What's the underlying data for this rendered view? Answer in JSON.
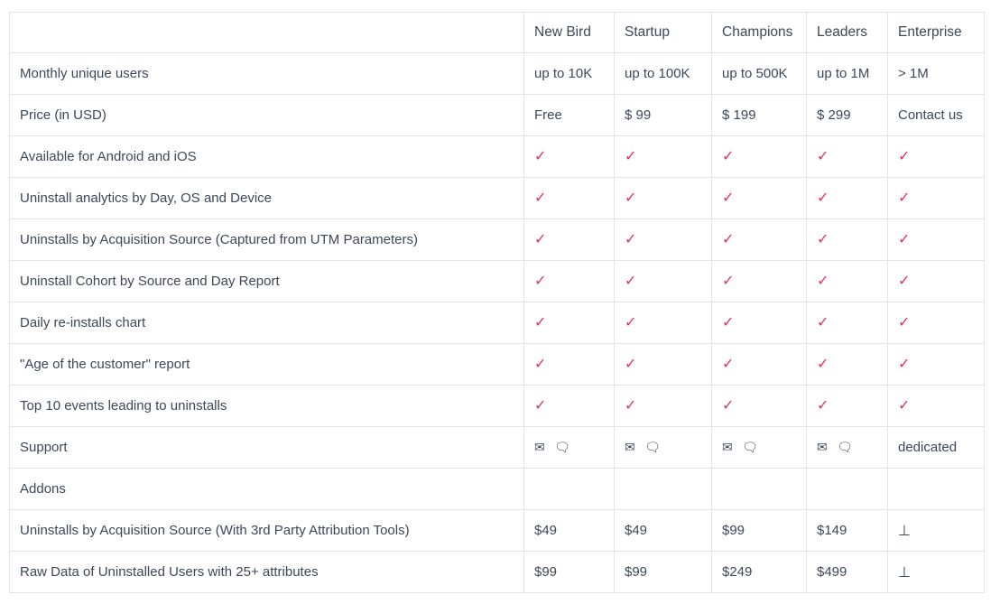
{
  "table": {
    "columns": [
      {
        "key": "feature",
        "label": ""
      },
      {
        "key": "plan1",
        "label": "New Bird"
      },
      {
        "key": "plan2",
        "label": "Startup"
      },
      {
        "key": "plan3",
        "label": "Champions"
      },
      {
        "key": "plan4",
        "label": "Leaders"
      },
      {
        "key": "plan5",
        "label": "Enterprise"
      }
    ],
    "colors": {
      "check": "#e8315c",
      "text": "#3c4858",
      "muted": "#9b9b9b",
      "border": "#e3e3e3"
    },
    "icons": {
      "check": "✓",
      "envelope": "✉",
      "chat": "🗨",
      "download": "⊥"
    },
    "rows": [
      {
        "label": "Monthly unique users",
        "style": "muted",
        "cells": [
          "up to 10K",
          "up to 100K",
          "up to 500K",
          "up to 1M",
          "> 1M"
        ],
        "cell_style": "muted"
      },
      {
        "label": "Price (in USD)",
        "style": "normal",
        "cells": [
          "Free",
          "$ 99",
          "$ 199",
          "$ 299",
          "Contact us"
        ],
        "cell_style": "normal"
      },
      {
        "label": "Available for Android and iOS",
        "style": "normal",
        "cells": [
          "✓",
          "✓",
          "✓",
          "✓",
          "✓"
        ],
        "cell_style": "check"
      },
      {
        "label": "Uninstall analytics by Day, OS and Device",
        "style": "normal",
        "cells": [
          "✓",
          "✓",
          "✓",
          "✓",
          "✓"
        ],
        "cell_style": "check"
      },
      {
        "label": "Uninstalls by Acquisition Source (Captured from UTM Parameters)",
        "style": "normal",
        "cells": [
          "✓",
          "✓",
          "✓",
          "✓",
          "✓"
        ],
        "cell_style": "check"
      },
      {
        "label": "Uninstall Cohort by Source and Day Report",
        "style": "normal",
        "cells": [
          "✓",
          "✓",
          "✓",
          "✓",
          "✓"
        ],
        "cell_style": "check"
      },
      {
        "label": "Daily re-installs chart",
        "style": "normal",
        "cells": [
          "✓",
          "✓",
          "✓",
          "✓",
          "✓"
        ],
        "cell_style": "check"
      },
      {
        "label": "\"Age of the customer\" report",
        "style": "normal",
        "cells": [
          "✓",
          "✓",
          "✓",
          "✓",
          "✓"
        ],
        "cell_style": "check"
      },
      {
        "label": "Top 10 events leading to uninstalls",
        "style": "normal",
        "cells": [
          "✓",
          "✓",
          "✓",
          "✓",
          "✓"
        ],
        "cell_style": "check"
      },
      {
        "label": "Support",
        "style": "normal",
        "cells": [
          "✉ 🗨",
          "✉ 🗨",
          "✉ 🗨",
          "✉ 🗨",
          "dedicated"
        ],
        "cell_style": "support"
      },
      {
        "label": "Addons",
        "style": "muted",
        "cells": [
          "",
          "",
          "",
          "",
          ""
        ],
        "cell_style": "empty"
      },
      {
        "label": "Uninstalls by Acquisition Source (With 3rd Party Attribution Tools)",
        "style": "normal",
        "cells": [
          "$49",
          "$49",
          "$99",
          "$149",
          "⊥"
        ],
        "cell_style": "price-dl"
      },
      {
        "label": "Raw Data of Uninstalled Users with 25+ attributes",
        "style": "normal",
        "cells": [
          "$99",
          "$99",
          "$249",
          "$499",
          "⊥"
        ],
        "cell_style": "price-dl"
      }
    ]
  }
}
